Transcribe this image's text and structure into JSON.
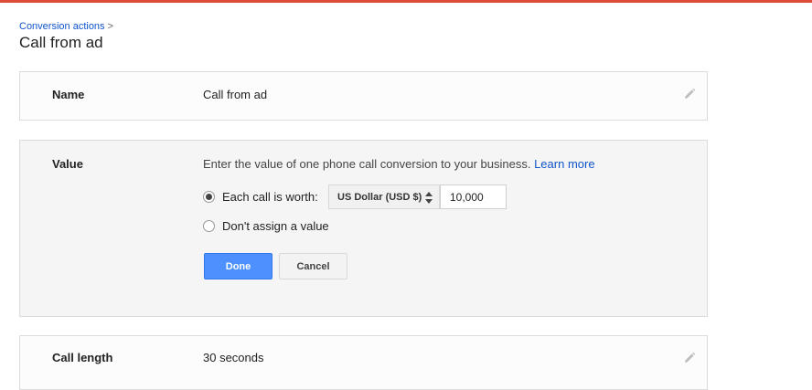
{
  "breadcrumb": {
    "parent": "Conversion actions",
    "separator": ">"
  },
  "page_title": "Call from ad",
  "name_section": {
    "label": "Name",
    "value": "Call from ad",
    "edit_icon": "pencil-icon"
  },
  "value_section": {
    "label": "Value",
    "description": "Enter the value of one phone call conversion to your business.",
    "learn_more": "Learn more",
    "options": [
      {
        "label": "Each call is worth:",
        "checked": true
      },
      {
        "label": "Don't assign a value",
        "checked": false
      }
    ],
    "currency": {
      "selected": "US Dollar (USD $)"
    },
    "amount": "10,000",
    "done_label": "Done",
    "cancel_label": "Cancel"
  },
  "call_length_section": {
    "label": "Call length",
    "value": "30 seconds",
    "edit_icon": "pencil-icon"
  },
  "colors": {
    "accent_bar": "#dd4b39",
    "primary_button": "#4d90fe",
    "link": "#1155cc"
  }
}
